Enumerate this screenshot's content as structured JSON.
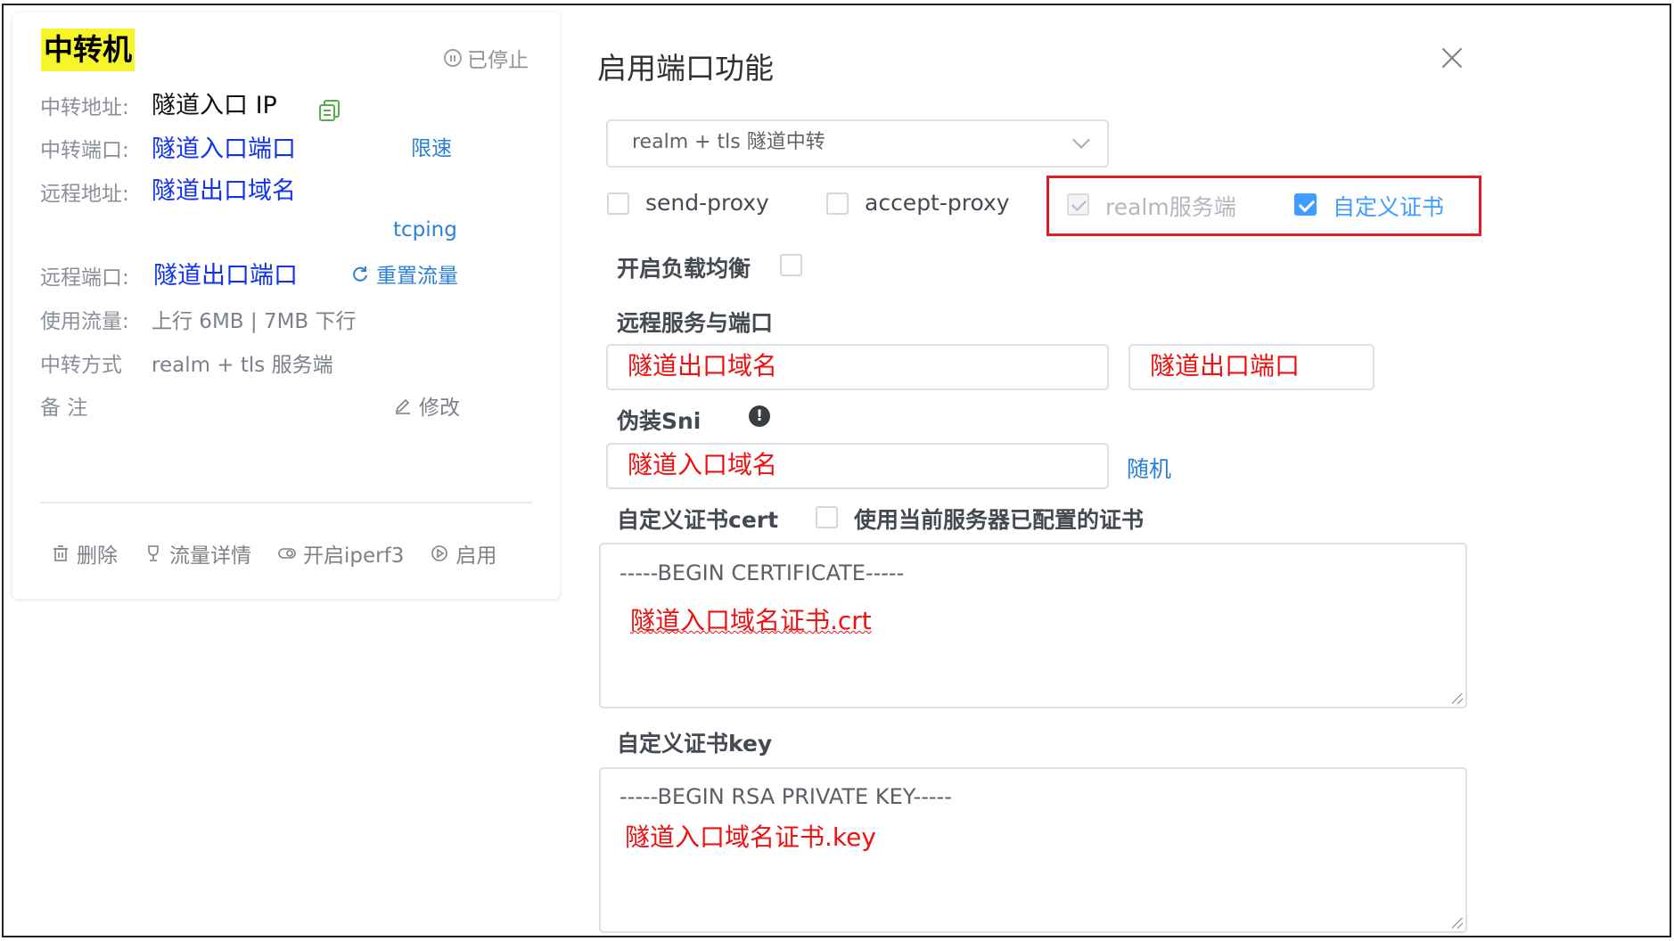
{
  "card": {
    "title": "中转机",
    "status": "已停止",
    "relay_address_label": "中转地址:",
    "relay_address_value": "隧道入口 IP",
    "relay_port_label": "中转端口:",
    "relay_port_value": "隧道入口端口",
    "rate_limit_link": "限速",
    "remote_address_label": "远程地址:",
    "remote_address_value": "隧道出口域名",
    "tcping_link": "tcping",
    "remote_port_label": "远程端口:",
    "remote_port_value": "隧道出口端口",
    "reset_traffic_link": "重置流量",
    "usage_label": "使用流量:",
    "usage_value": "上行 6MB | 7MB 下行",
    "mode_label": "中转方式",
    "mode_value": "realm + tls 服务端",
    "note_label": "备 注",
    "edit_link": "修改",
    "actions": {
      "delete": "删除",
      "traffic_detail": "流量详情",
      "iperf3": "开启iperf3",
      "enable": "启用"
    }
  },
  "dialog": {
    "title": "启用端口功能",
    "mode_select_value": "realm + tls 隧道中转",
    "send_proxy_label": "send-proxy",
    "accept_proxy_label": "accept-proxy",
    "realm_server_label": "realm服务端",
    "custom_cert_label": "自定义证书",
    "load_balance_label": "开启负载均衡",
    "remote_section_label": "远程服务与端口",
    "remote_host_value": "隧道出口域名",
    "remote_port_value": "隧道出口端口",
    "sni_label": "伪装Sni",
    "sni_value": "隧道入口域名",
    "random_link": "随机",
    "cert_label": "自定义证书cert",
    "use_current_cert_label": "使用当前服务器已配置的证书",
    "cert_placeholder": "-----BEGIN CERTIFICATE-----",
    "cert_value": "隧道入口域名证书.crt",
    "key_label": "自定义证书key",
    "key_placeholder": "-----BEGIN RSA PRIVATE KEY-----",
    "key_value": "隧道入口域名证书.key"
  },
  "colors": {
    "accent_blue": "#409eff",
    "link_blue": "#2b7fd8",
    "value_blue": "#1133ee",
    "annotation_red": "#ee1111",
    "highlight_yellow": "#f6f52a"
  }
}
